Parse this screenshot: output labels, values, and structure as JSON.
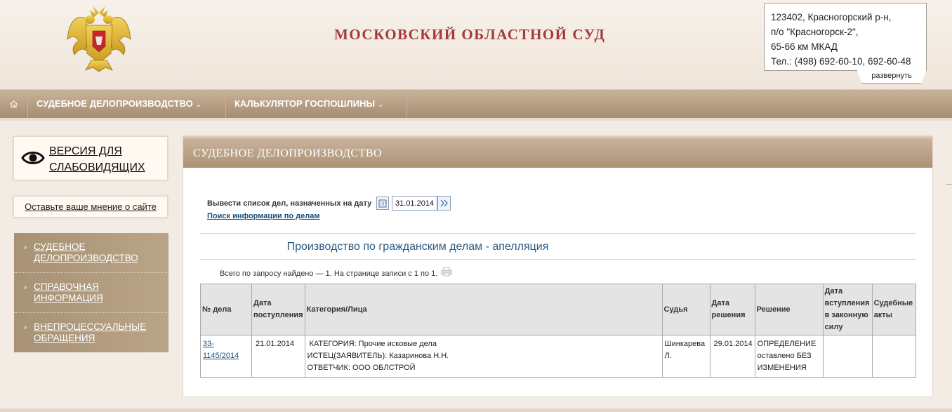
{
  "header": {
    "site_title": "МОСКОВСКИЙ ОБЛАСТНОЙ СУД",
    "address_lines": [
      "123402, Красногорский р-н,",
      "п/о \"Красногорск-2\",",
      "65-66 км МКАД",
      "Тел.: (498) 692-60-10, 692-60-48"
    ],
    "expand_label": "развернуть",
    "emblem_icon": "coat-of-arms-icon"
  },
  "nav": {
    "home_icon": "home-icon",
    "items": [
      {
        "label": "СУДЕБНОЕ ДЕЛОПРОИЗВОДСТВО"
      },
      {
        "label": "КАЛЬКУЛЯТОР ГОСПОШЛИНЫ"
      }
    ]
  },
  "sidebar": {
    "vi_link": "ВЕРСИЯ ДЛЯ СЛАБОВИДЯЩИХ",
    "opinion_link": "Оставьте ваше мнение о сайте",
    "menu": [
      {
        "label": "СУДЕБНОЕ ДЕЛОПРОИЗВОДСТВО"
      },
      {
        "label": "СПРАВОЧНАЯ ИНФОРМАЦИЯ"
      },
      {
        "label": "ВНЕПРОЦЕССУАЛЬНЫЕ ОБРАЩЕНИЯ"
      }
    ]
  },
  "main": {
    "title": "СУДЕБНОЕ ДЕЛОПРОИЗВОДСТВО",
    "date_label": "Вывести список дел, назначенных на дату",
    "date_value": "31.01.2014",
    "search_link": "Поиск информации по делам",
    "section_title": "Производство по гражданским делам - апелляция",
    "found_text": "Всего по запросу найдено — 1. На странице записи с 1 по 1.",
    "table": {
      "headers": [
        "№ дела",
        "Дата поступления",
        "Категория/Лица",
        "Судья",
        "Дата решения",
        "Решение",
        "Дата вступления в законную силу",
        "Судебные акты"
      ],
      "rows": [
        {
          "case_no": "33-1145/2014",
          "received": "21.01.2014",
          "category_lines": [
            "КАТЕГОРИЯ: Прочие исковые дела",
            "ИСТЕЦ(ЗАЯВИТЕЛЬ): Казаринова Н.Н.",
            "ОТВЕТЧИК: ООО ОБЛСТРОЙ"
          ],
          "judge": "Шинкарева Л.",
          "decision_date": "29.01.2014",
          "decision": "ОПРЕДЕЛЕНИЕ оставлено БЕЗ ИЗМЕНЕНИЯ",
          "effective_date": "",
          "acts": ""
        }
      ]
    }
  },
  "colors": {
    "title_red": "#a33a3a",
    "nav_brown": "#a68c70",
    "link_blue": "#1a4f7a",
    "section_blue": "#2b5a84"
  }
}
